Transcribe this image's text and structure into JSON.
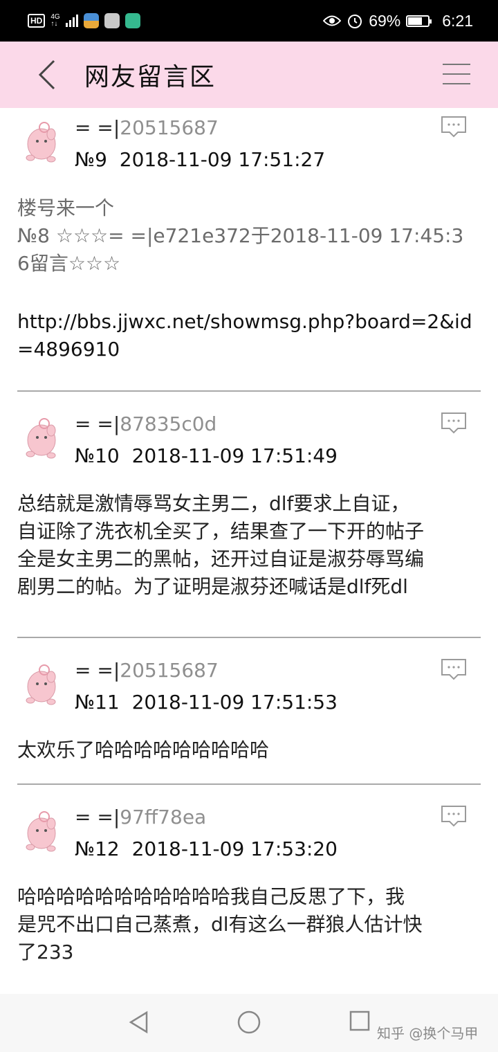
{
  "status_bar": {
    "hd": "HD",
    "network": "4G",
    "battery_percent": "69%",
    "battery_level": 0.69,
    "time": "6:21",
    "icons": [
      "wifi-hd-icon",
      "signal-icon",
      "app-icon-1",
      "app-icon-2",
      "app-icon-3",
      "eye-icon",
      "alarm-icon",
      "battery-icon"
    ]
  },
  "header": {
    "title": "网友留言区",
    "back_icon": "chevron-left-icon",
    "menu_icon": "hamburger-menu-icon",
    "background": "#fbd9e9"
  },
  "posts": [
    {
      "user_prefix": "= =|",
      "user_id": "20515687",
      "number": "№9",
      "datetime": "2018-11-09 17:51:27",
      "lines": [
        "楼号来一个"
      ],
      "quote": "№8 ☆☆☆= =|e721e372于2018-11-09 17:45:3",
      "quote2": "6留言☆☆☆",
      "link1": "http://bbs.jjwxc.net/showmsg.php?board=2&id",
      "link2": "=4896910"
    },
    {
      "user_prefix": "= =|",
      "user_id": "87835c0d",
      "number": "№10",
      "datetime": "2018-11-09 17:51:49",
      "lines": [
        "总结就是激情辱骂女主男二，dlf要求上自证，",
        "自证除了洗衣机全买了，结果查了一下开的帖子",
        "全是女主男二的黑帖，还开过自证是淑芬辱骂编",
        "剧男二的帖。为了证明是淑芬还喊话是dlf死dl"
      ]
    },
    {
      "user_prefix": "= =|",
      "user_id": "20515687",
      "number": "№11",
      "datetime": "2018-11-09 17:51:53",
      "lines": [
        "太欢乐了哈哈哈哈哈哈哈哈哈"
      ]
    },
    {
      "user_prefix": "= =|",
      "user_id": "97ff78ea",
      "number": "№12",
      "datetime": "2018-11-09 17:53:20",
      "lines": [
        "哈哈哈哈哈哈哈哈哈哈哈我自己反思了下，我",
        "是咒不出口自己蒸煮，dl有这么一群狼人估计快",
        "了233"
      ]
    }
  ],
  "nav_bar": {
    "icons": [
      "back-triangle-icon",
      "home-circle-icon",
      "recents-square-icon"
    ]
  },
  "watermark": "知乎 @换个马甲"
}
